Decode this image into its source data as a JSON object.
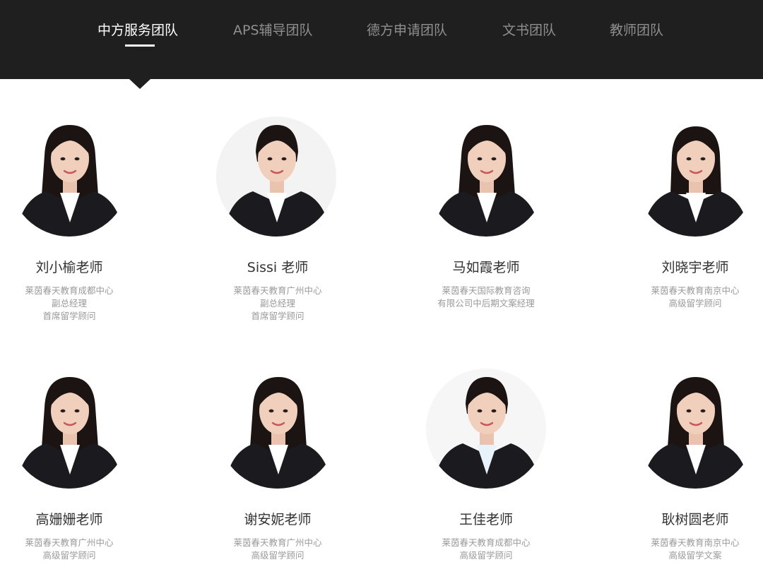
{
  "tabs": [
    {
      "label": "中方服务团队",
      "active": true
    },
    {
      "label": "APS辅导团队",
      "active": false
    },
    {
      "label": "德方申请团队",
      "active": false
    },
    {
      "label": "文书团队",
      "active": false
    },
    {
      "label": "教师团队",
      "active": false
    }
  ],
  "teachers": [
    {
      "name": "刘小榆老师",
      "lines": [
        "莱茵春天教育成都中心",
        "副总经理",
        "首席留学顾问"
      ],
      "hair": "long",
      "shirt": "#ffffff",
      "bg": "#ffffff"
    },
    {
      "name": "Sissi 老师",
      "lines": [
        "莱茵春天教育广州中心",
        "副总经理",
        "首席留学顾问"
      ],
      "hair": "bun",
      "shirt": "#ffffff",
      "bg": "#f3f3f3"
    },
    {
      "name": "马如霞老师",
      "lines": [
        "莱茵春天国际教育咨询",
        "有限公司中后期文案经理"
      ],
      "hair": "long",
      "shirt": "#ffffff",
      "bg": "#ffffff"
    },
    {
      "name": "刘晓宇老师",
      "lines": [
        "莱茵春天教育南京中心",
        "高级留学顾问"
      ],
      "hair": "medium",
      "shirt": "#ffffff",
      "bg": "#ffffff"
    },
    {
      "name": "高姗姗老师",
      "lines": [
        "莱茵春天教育广州中心",
        "高级留学顾问"
      ],
      "hair": "long",
      "shirt": "#ffffff",
      "bg": "#ffffff"
    },
    {
      "name": "谢安妮老师",
      "lines": [
        "莱茵春天教育广州中心",
        "高级留学顾问"
      ],
      "hair": "long",
      "shirt": "#ffffff",
      "bg": "#ffffff"
    },
    {
      "name": "王佳老师",
      "lines": [
        "莱茵春天教育成都中心",
        "高级留学顾问"
      ],
      "hair": "bun",
      "shirt": "#e8f2fb",
      "bg": "#f6f6f6"
    },
    {
      "name": "耿树圆老师",
      "lines": [
        "莱茵春天教育南京中心",
        "高级留学文案"
      ],
      "hair": "long",
      "shirt": "#ffffff",
      "bg": "#ffffff"
    }
  ]
}
